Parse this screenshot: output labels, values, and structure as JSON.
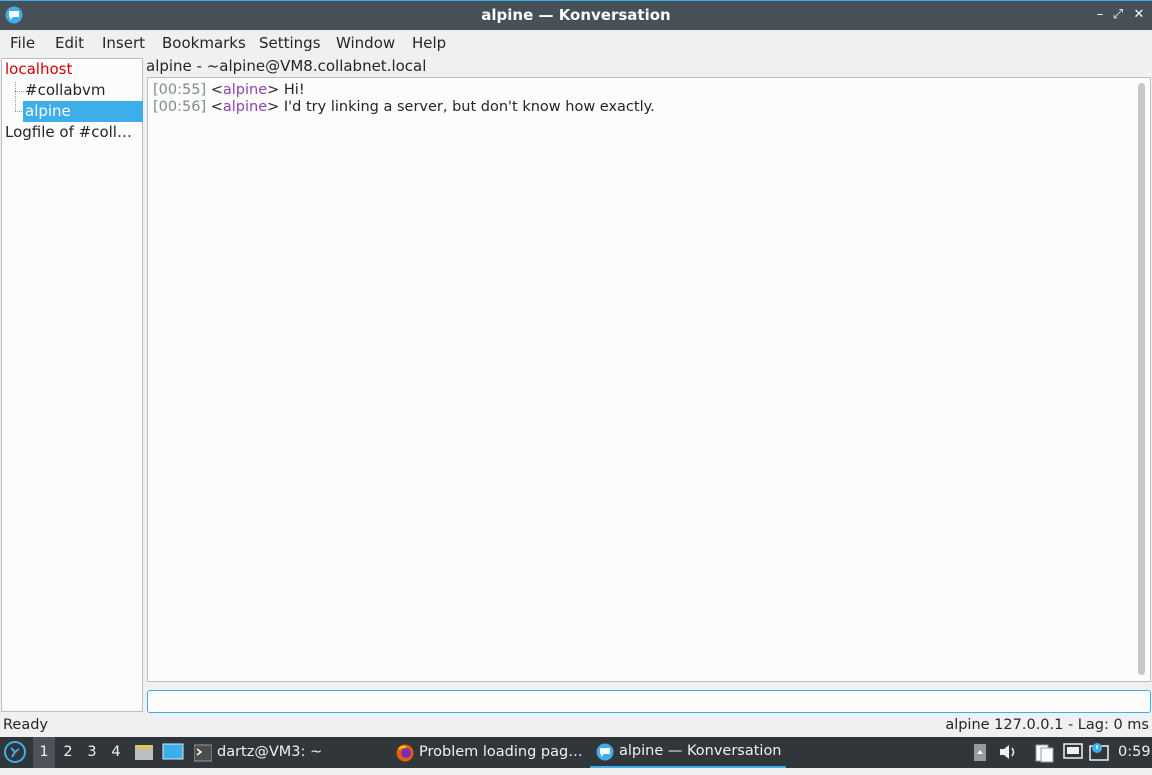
{
  "window": {
    "title": "alpine — Konversation",
    "buttons": {
      "minimize": "–",
      "maximize": "⤢",
      "close": "✕"
    }
  },
  "menu": [
    "File",
    "Edit",
    "Insert",
    "Bookmarks",
    "Settings",
    "Window",
    "Help"
  ],
  "sidebar": {
    "server": "localhost",
    "channel": "#collabvm",
    "query": "alpine",
    "logfile": "Logfile of #collab…"
  },
  "topic": "alpine - ~alpine@VM8.collabnet.local",
  "messages": [
    {
      "time": "[00:55]",
      "nick": "alpine",
      "text": "Hi!"
    },
    {
      "time": "[00:56]",
      "nick": "alpine",
      "text": "I'd try linking a server, but don't know how exactly."
    }
  ],
  "input": {
    "value": ""
  },
  "status": {
    "left": "Ready",
    "right": "alpine  127.0.0.1 - Lag: 0 ms"
  },
  "taskbar": {
    "desktops": [
      "1",
      "2",
      "3",
      "4"
    ],
    "tasks": {
      "terminal": "dartz@VM3: ~",
      "firefox": "Problem loading pag…",
      "konversation": "alpine — Konversation"
    },
    "clock": "0:59"
  },
  "colors": {
    "accent": "#3daee9",
    "server": "#d00000",
    "nick": "#8e44ad",
    "timestamp": "#7f8c8d",
    "selection": "#3daee9"
  }
}
